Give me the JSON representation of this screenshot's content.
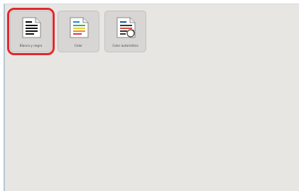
{
  "tiles": [
    {
      "label": "Blanco y negro",
      "icon": "black-white-document-icon",
      "selected": true
    },
    {
      "label": "Color",
      "icon": "color-document-icon",
      "selected": false
    },
    {
      "label": "Color automático",
      "icon": "auto-color-document-icon",
      "selected": false
    }
  ],
  "colors": {
    "selection": "#e0282f",
    "panel": "#e8e6e3",
    "tile": "#d7d6d4"
  }
}
